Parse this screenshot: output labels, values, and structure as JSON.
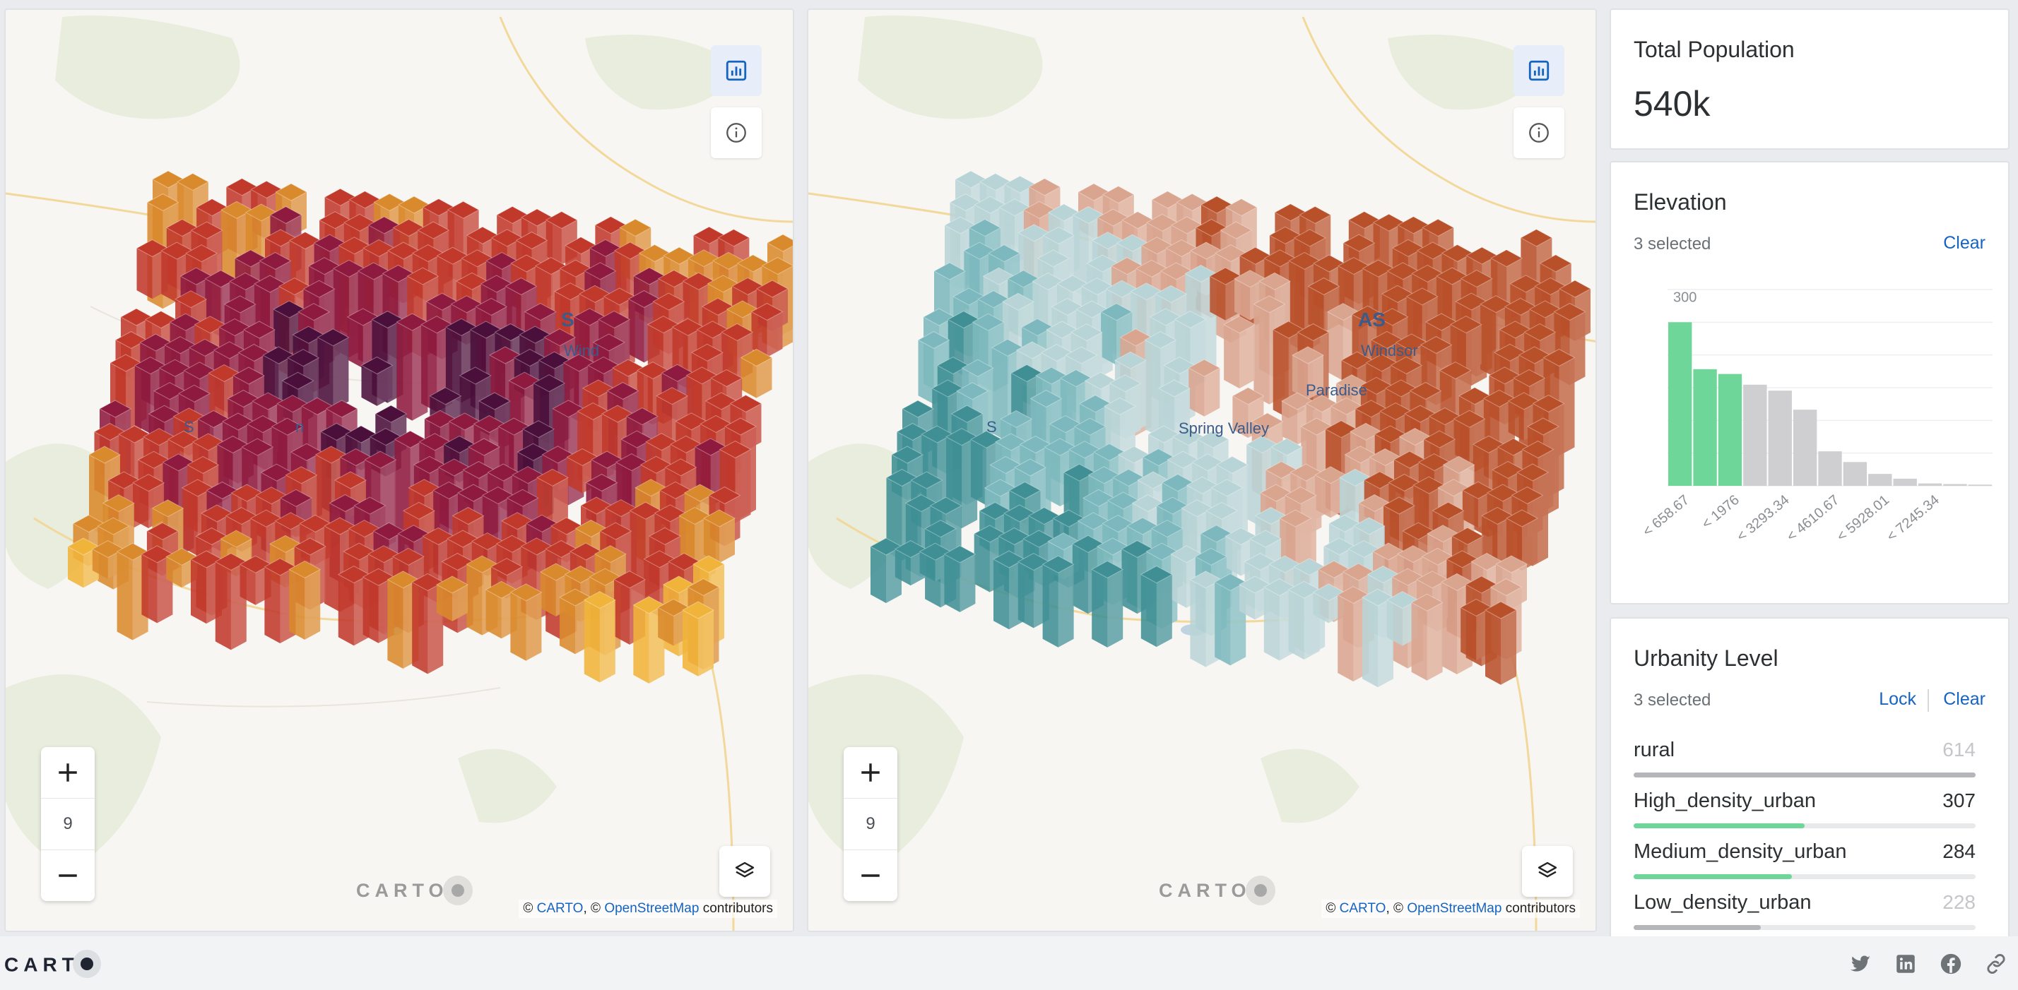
{
  "maps": [
    {
      "zoom_level": "9",
      "watermark": "CARTO",
      "attribution": {
        "prefix": "© ",
        "carto": "CARTO",
        "sep": ", © ",
        "osm": "OpenStreetMap",
        "suffix": " contributors"
      },
      "labels": [
        {
          "text": "S"
        },
        {
          "text": "Wind"
        },
        {
          "text": "S"
        },
        {
          "text": "n"
        }
      ],
      "ramp": [
        "#f0b43a",
        "#d98a2c",
        "#c0392b",
        "#8e1a3f",
        "#4a0f3a"
      ]
    },
    {
      "zoom_level": "9",
      "watermark": "CARTO",
      "attribution": {
        "prefix": "© ",
        "carto": "CARTO",
        "sep": ", © ",
        "osm": "OpenStreetMap",
        "suffix": " contributors"
      },
      "labels": [
        {
          "text": "AS"
        },
        {
          "text": "Windsor"
        },
        {
          "text": "Paradise"
        },
        {
          "text": "Spring Valley"
        },
        {
          "text": "S"
        }
      ],
      "ramp": [
        "#3f8f94",
        "#7cb8bd",
        "#b9d4d6",
        "#d9a58f",
        "#b8502a"
      ]
    }
  ],
  "icons": {
    "widgets": "bar-chart-icon",
    "info": "info-icon",
    "layers": "layers-icon",
    "zoom_in": "plus-icon",
    "zoom_out": "minus-icon"
  },
  "total_population": {
    "title": "Total Population",
    "value": "540k"
  },
  "elevation": {
    "title": "Elevation",
    "selected_text": "3 selected",
    "clear_label": "Clear",
    "chart_data": {
      "type": "bar",
      "title": "",
      "ylabel": "",
      "y_tick_label": "300",
      "ylim": [
        0,
        330
      ],
      "tick_labels": [
        "< 658.67",
        "< 1976",
        "< 3293.34",
        "< 4610.67",
        "< 5928.01",
        "< 7245.34"
      ],
      "values": [
        275,
        196,
        188,
        170,
        160,
        128,
        58,
        40,
        20,
        12,
        4,
        3,
        2
      ],
      "selected_count": 3,
      "selected_color": "#6fd69a",
      "unselected_color": "#cfcfd1"
    }
  },
  "urbanity": {
    "title": "Urbanity Level",
    "selected_text": "3 selected",
    "lock_label": "Lock",
    "clear_label": "Clear",
    "max": 614,
    "categories": [
      {
        "name": "rural",
        "value": "614",
        "num": 614,
        "selected": false
      },
      {
        "name": "High_density_urban",
        "value": "307",
        "num": 307,
        "selected": true
      },
      {
        "name": "Medium_density_urban",
        "value": "284",
        "num": 284,
        "selected": true
      },
      {
        "name": "Low_density_urban",
        "value": "228",
        "num": 228,
        "selected": false
      }
    ],
    "colors": {
      "selected": "#6fd69a",
      "unselected": "#b4b6b9"
    }
  },
  "footer": {
    "logo": "CART",
    "social": [
      "twitter-icon",
      "linkedin-icon",
      "facebook-icon",
      "link-icon"
    ]
  }
}
